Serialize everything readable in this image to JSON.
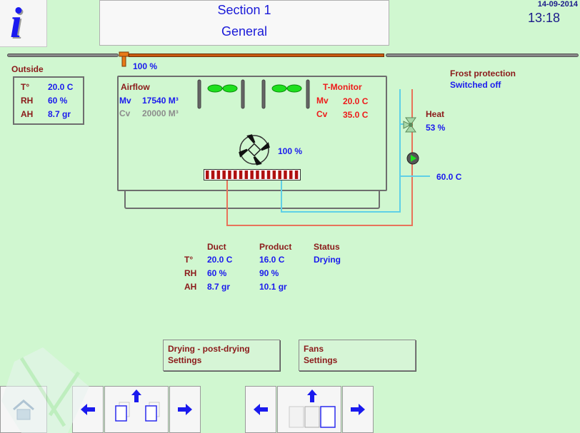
{
  "header": {
    "info_button_glyph": "i",
    "title_line1": "Section 1",
    "title_line2": "General",
    "date": "14-09-2014",
    "time": "13:18"
  },
  "damper": {
    "opening": "100 %"
  },
  "outside": {
    "label": "Outside",
    "rows": [
      {
        "label": "T°",
        "value": "20.0  C"
      },
      {
        "label": "RH",
        "value": "60  %"
      },
      {
        "label": "AH",
        "value": "8.7  gr"
      }
    ]
  },
  "airflow": {
    "title": "Airflow",
    "mv_label": "Mv",
    "mv_value": "17540  M³",
    "cv_label": "Cv",
    "cv_value": "20000  M³"
  },
  "t_monitor": {
    "title": "T-Monitor",
    "mv_label": "Mv",
    "mv_value": "20.0  C",
    "cv_label": "Cv",
    "cv_value": "35.0  C"
  },
  "fan": {
    "speed": "100  %"
  },
  "frost_protection": {
    "label": "Frost protection",
    "status": "Switched off"
  },
  "heat": {
    "label": "Heat",
    "valve_opening": "53  %",
    "water_temp": "60.0  C"
  },
  "measurements": {
    "columns": [
      "Duct",
      "Product",
      "Status"
    ],
    "rows": [
      {
        "label": "T°",
        "duct": "20.0  C",
        "product": "16.0  C"
      },
      {
        "label": "RH",
        "duct": "60  %",
        "product": "90  %"
      },
      {
        "label": "AH",
        "duct": "8.7  gr",
        "product": "10.1  gr"
      }
    ],
    "status": "Drying"
  },
  "buttons": {
    "drying_settings_line1": "Drying  -  post-drying",
    "drying_settings_line2": "Settings",
    "fans_settings_line1": "Fans",
    "fans_settings_line2": "Settings"
  },
  "nav": {
    "home_icon": "home-icon",
    "prev_icon": "arrow-left-icon",
    "next_icon": "arrow-right-icon",
    "up_icon": "arrow-up-icon"
  },
  "colors": {
    "background": "#d0f7d0",
    "label_red": "#8b1a1a",
    "value_blue": "#1a1aee",
    "alarm_red": "#ee1a1a",
    "supply_water": "#e8735a",
    "return_water": "#5fd0e6"
  }
}
